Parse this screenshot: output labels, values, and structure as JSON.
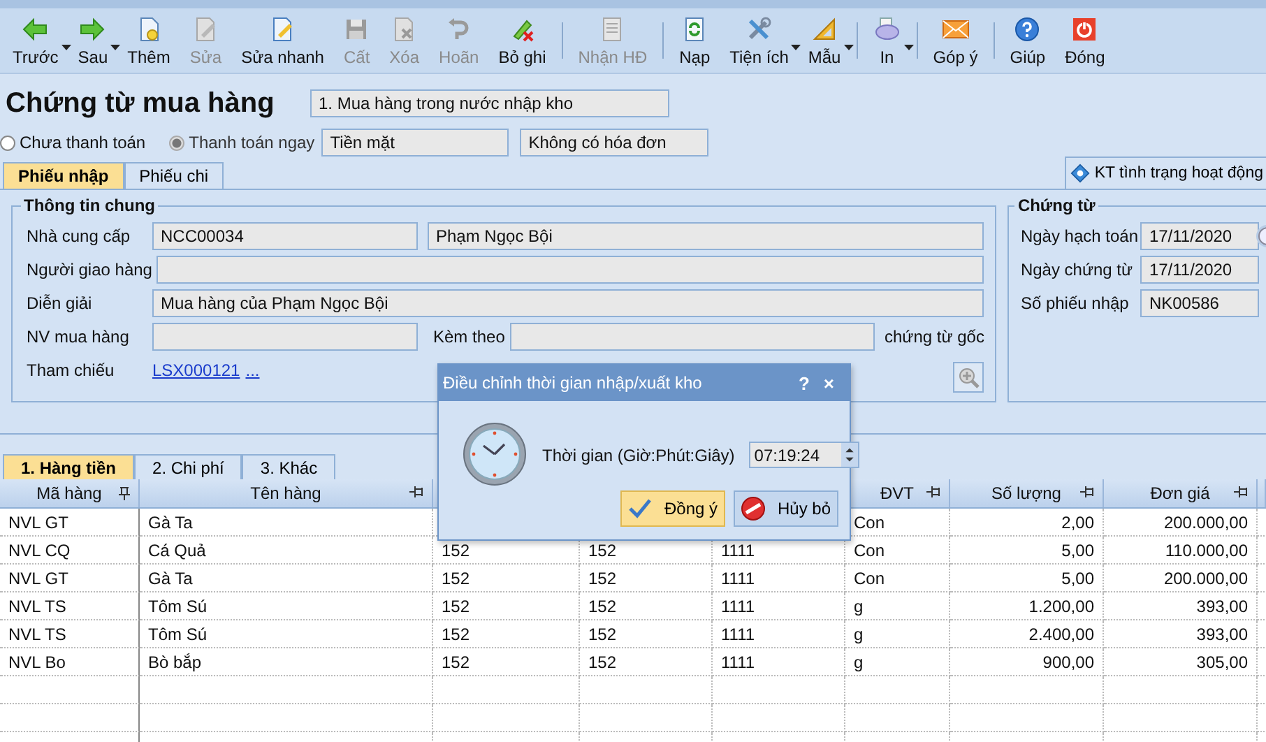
{
  "toolbar": {
    "items": [
      {
        "kind": "back",
        "label": "Trước",
        "disabled": false,
        "dropdown": true
      },
      {
        "kind": "forward",
        "label": "Sau",
        "disabled": false,
        "dropdown": true
      },
      {
        "kind": "new",
        "label": "Thêm",
        "disabled": false,
        "dropdown": false
      },
      {
        "kind": "edit",
        "label": "Sửa",
        "disabled": true,
        "dropdown": false
      },
      {
        "kind": "quick-edit",
        "label": "Sửa nhanh",
        "disabled": false,
        "dropdown": false
      },
      {
        "kind": "save",
        "label": "Cất",
        "disabled": true,
        "dropdown": false
      },
      {
        "kind": "delete",
        "label": "Xóa",
        "disabled": true,
        "dropdown": false
      },
      {
        "kind": "undo",
        "label": "Hoãn",
        "disabled": true,
        "dropdown": false
      },
      {
        "kind": "unpost",
        "label": "Bỏ ghi",
        "disabled": false,
        "dropdown": false
      },
      {
        "kind": "separator"
      },
      {
        "kind": "invoice",
        "label": "Nhận HĐ",
        "disabled": true,
        "dropdown": false
      },
      {
        "kind": "separator"
      },
      {
        "kind": "reload",
        "label": "Nạp",
        "disabled": false,
        "dropdown": false
      },
      {
        "kind": "tools",
        "label": "Tiện ích",
        "disabled": false,
        "dropdown": true
      },
      {
        "kind": "template",
        "label": "Mẫu",
        "disabled": false,
        "dropdown": true
      },
      {
        "kind": "separator"
      },
      {
        "kind": "print",
        "label": "In",
        "disabled": false,
        "dropdown": true
      },
      {
        "kind": "separator"
      },
      {
        "kind": "feedback",
        "label": "Góp ý",
        "disabled": false,
        "dropdown": false
      },
      {
        "kind": "separator"
      },
      {
        "kind": "help",
        "label": "Giúp",
        "disabled": false,
        "dropdown": false
      },
      {
        "kind": "close",
        "label": "Đóng",
        "disabled": false,
        "dropdown": false
      }
    ]
  },
  "header": {
    "title": "Chứng từ mua hàng",
    "voucher_type": "1. Mua hàng trong nước nhập kho",
    "payment_options": [
      {
        "label": "Chưa thanh toán",
        "selected": false,
        "disabled": false
      },
      {
        "label": "Thanh toán ngay",
        "selected": true,
        "disabled": true
      }
    ],
    "payment_method": "Tiền mặt",
    "invoice_status": "Không có hóa đơn"
  },
  "tabs": [
    {
      "label": "Phiếu nhập",
      "selected": true
    },
    {
      "label": "Phiếu chi",
      "selected": false
    }
  ],
  "status_check_button": "KT tình trạng hoạt động",
  "general_info": {
    "title": "Thông tin chung",
    "supplier_label": "Nhà cung cấp",
    "supplier_code": "NCC00034",
    "supplier_name": "Phạm Ngọc Bội",
    "deliverer_label": "Người giao hàng",
    "description_label": "Diễn giải",
    "description": "Mua hàng của Phạm Ngọc Bội",
    "buyer_label": "NV mua hàng",
    "attached_label": "Kèm theo",
    "attached_suffix": "chứng từ gốc",
    "reference_label": "Tham chiếu",
    "reference_link": "LSX000121",
    "reference_more": "..."
  },
  "voucher": {
    "title": "Chứng từ",
    "fields": [
      {
        "label": "Ngày hạch toán",
        "value": "17/11/2020",
        "kind": "date"
      },
      {
        "label": "Ngày chứng từ",
        "value": "17/11/2020",
        "kind": "text"
      },
      {
        "label": "Số phiếu nhập",
        "value": "NK00586",
        "kind": "text"
      }
    ]
  },
  "detail_tabs": [
    {
      "label": "1. Hàng tiền",
      "selected": true
    },
    {
      "label": "2. Chi phí",
      "selected": false
    },
    {
      "label": "3. Khác",
      "selected": false
    }
  ],
  "table": {
    "columns": [
      {
        "label": "Mã hàng",
        "pinned": true
      },
      {
        "label": "Tên hàng",
        "pinned": false
      },
      {},
      {},
      {},
      {
        "label": "ĐVT",
        "pinned": false
      },
      {
        "label": "Số lượng",
        "pinned": false
      },
      {
        "label": "Đơn giá",
        "pinned": false
      }
    ],
    "rows": [
      [
        "NVL GT",
        "Gà Ta",
        null,
        null,
        null,
        "Con",
        "2,00",
        "200.000,00"
      ],
      [
        "NVL CQ",
        "Cá Quả",
        "152",
        "152",
        "1111",
        "Con",
        "5,00",
        "110.000,00"
      ],
      [
        "NVL GT",
        "Gà Ta",
        "152",
        "152",
        "1111",
        "Con",
        "5,00",
        "200.000,00"
      ],
      [
        "NVL TS",
        "Tôm Sú",
        "152",
        "152",
        "1111",
        "g",
        "1.200,00",
        "393,00"
      ],
      [
        "NVL TS",
        "Tôm Sú",
        "152",
        "152",
        "1111",
        "g",
        "2.400,00",
        "393,00"
      ],
      [
        "NVL Bo",
        "Bò bắp",
        "152",
        "152",
        "1111",
        "g",
        "900,00",
        "305,00"
      ]
    ]
  },
  "dialog": {
    "title": "Điều chỉnh thời gian nhập/xuất kho",
    "help": "?",
    "close": "×",
    "time_label": "Thời gian (Giờ:Phút:Giây)",
    "time_value": "07:19:24",
    "buttons": [
      {
        "label": "Đồng ý",
        "kind": "ok",
        "selected": true
      },
      {
        "label": "Hủy bỏ",
        "kind": "cancel",
        "selected": false
      }
    ]
  }
}
